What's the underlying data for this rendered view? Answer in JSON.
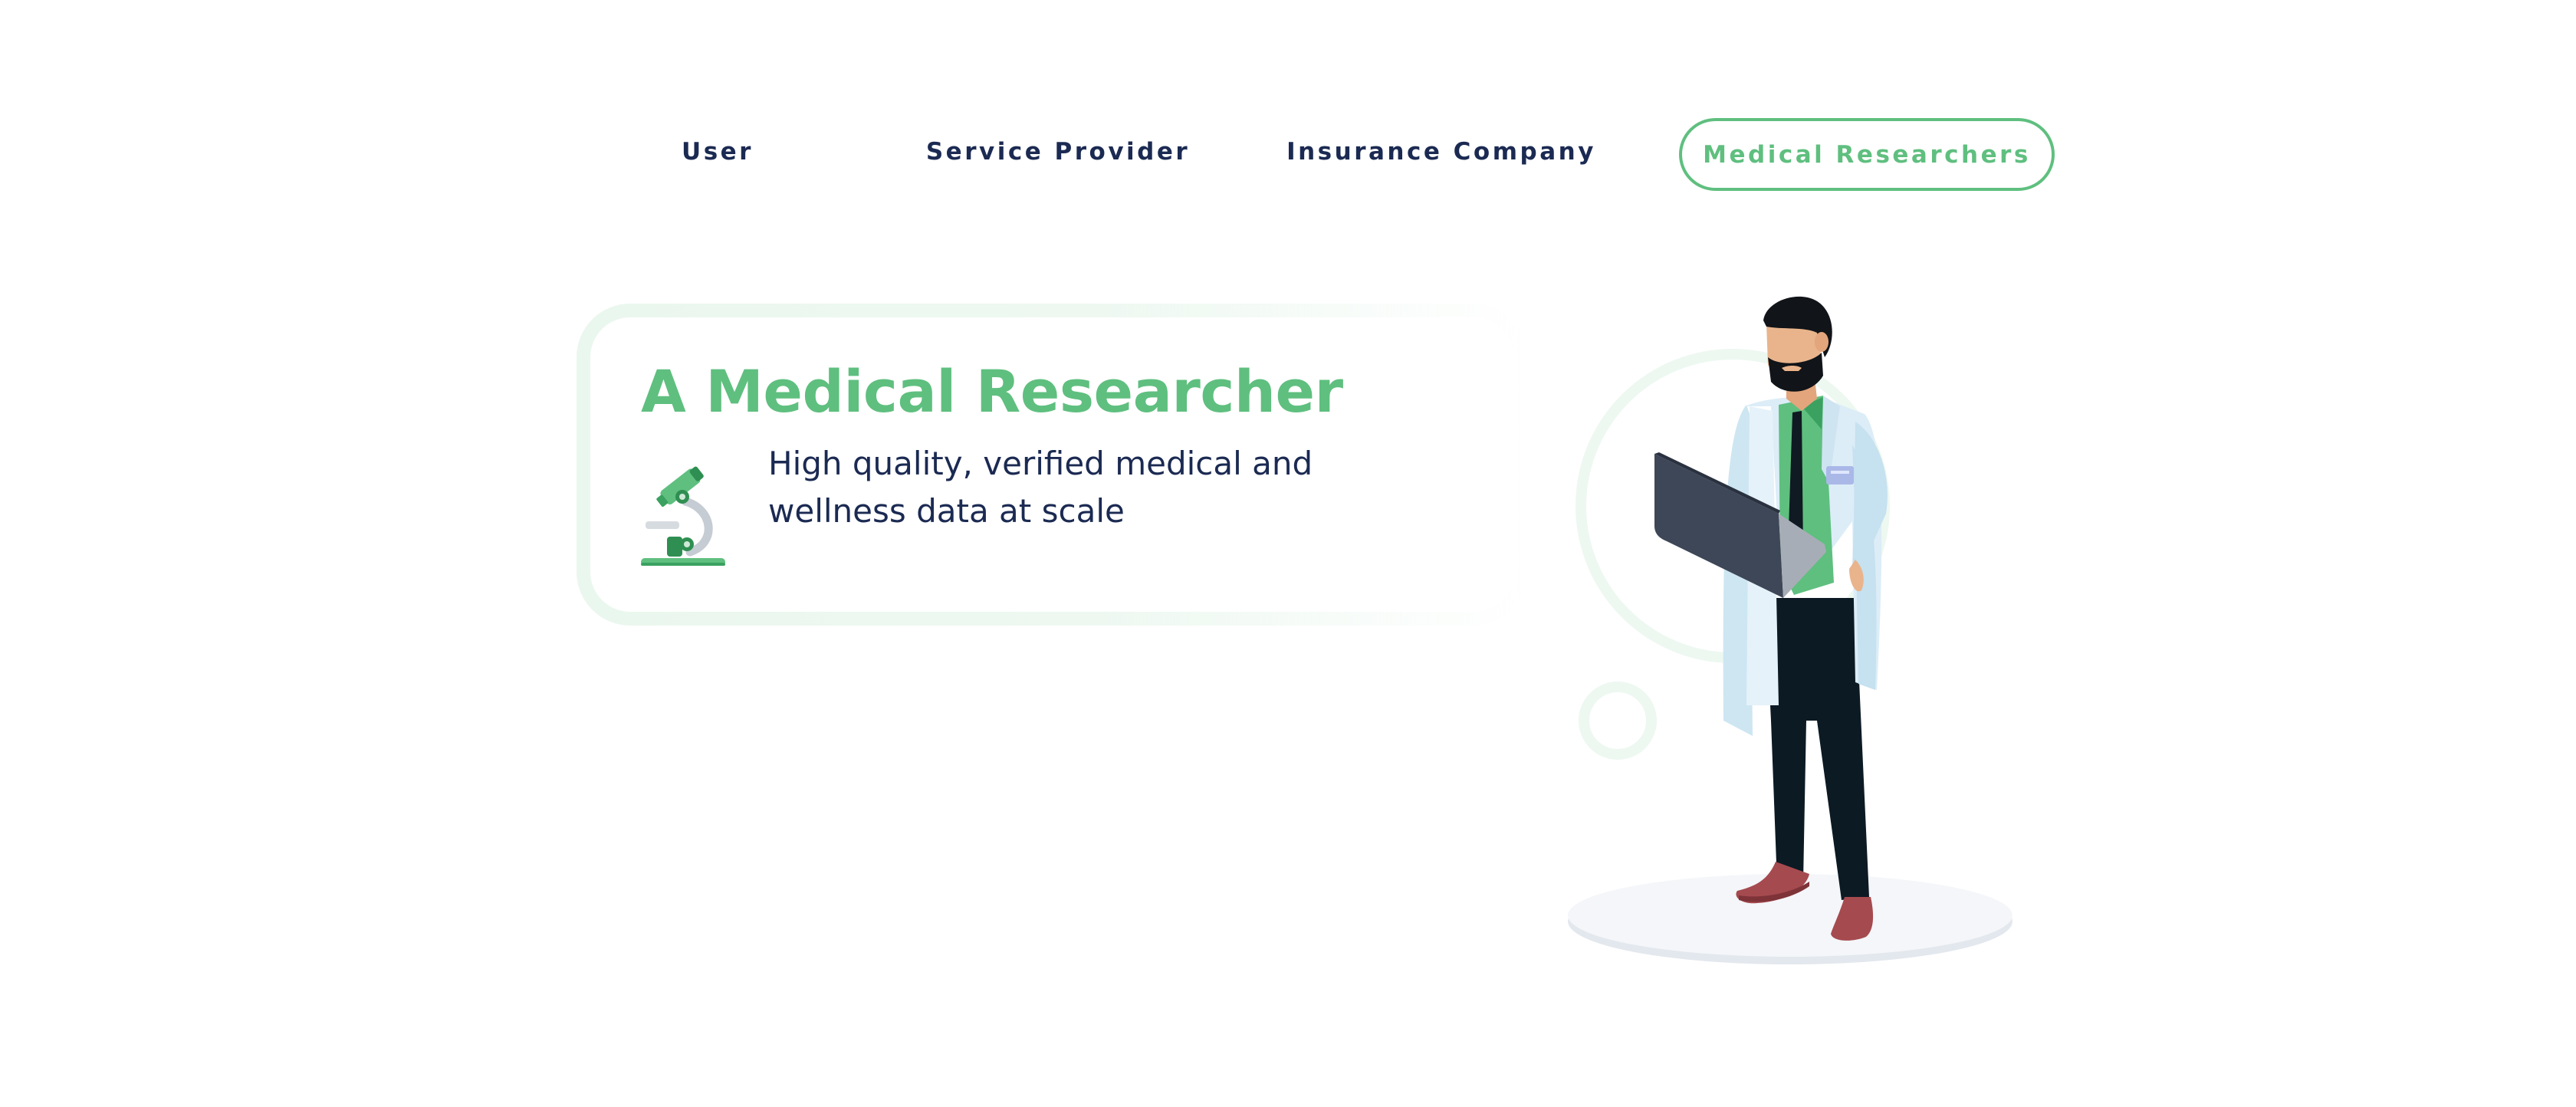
{
  "tabs": [
    {
      "label": "User",
      "active": false
    },
    {
      "label": "Service Provider",
      "active": false
    },
    {
      "label": "Insurance Company",
      "active": false
    },
    {
      "label": "Medical Researchers",
      "active": true
    }
  ],
  "card": {
    "title": "A Medical Researcher",
    "description": "High quality, verified medical and wellness data at scale",
    "icon": "microscope-icon"
  },
  "illustration": {
    "subject": "doctor-with-laptop-illustration"
  },
  "colors": {
    "accent": "#5fbf7f",
    "text_dark": "#1b2a52",
    "card_border": "#eaf7ee"
  }
}
